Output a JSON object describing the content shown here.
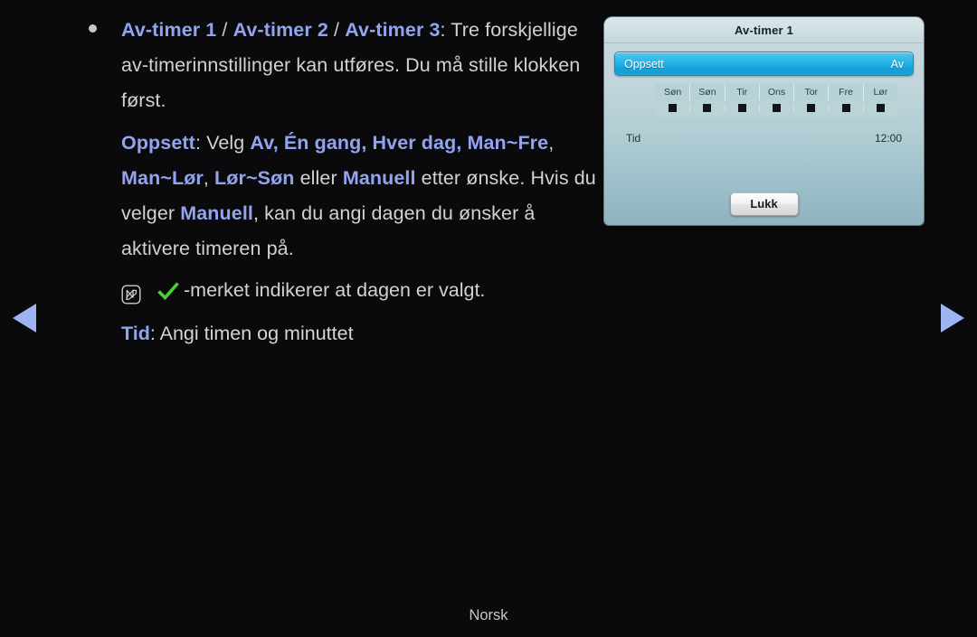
{
  "page": {
    "footer_language": "Norsk",
    "accent_color": "#93a4ef",
    "background_color": "#0a0a0c",
    "text_color": "#d2d2d2"
  },
  "nav": {
    "prev_icon": "triangle-left-icon",
    "next_icon": "triangle-right-icon",
    "arrow_color": "#9db3f2"
  },
  "help": {
    "bullet": {
      "term_1": "Av-timer 1",
      "sep_1": " / ",
      "term_2": "Av-timer 2",
      "sep_2": " / ",
      "term_3": "Av-timer 3",
      "body": ": Tre forskjellige av-timerinnstillinger kan utføres. Du må stille klokken først."
    },
    "setup": {
      "term": "Oppsett",
      "lead": ": Velg ",
      "option_1": "Av,",
      "option_2": "Én gang,",
      "option_3": "Hver dag,",
      "option_4": "Man~Fre",
      "option_5": "Man~Lør",
      "option_6": "Lør~Søn",
      "conj": "eller",
      "option_7": "Manuell",
      "tail_1": "etter ønske. Hvis du velger ",
      "option_7_repeat": "Manuell",
      "tail_2": ", kan du angi dagen du ønsker å aktivere timeren på."
    },
    "note": {
      "icon": "note-pen-icon",
      "check_icon": "green-check-icon",
      "check_color": "#44d62c",
      "text": "-merket indikerer at dagen er valgt."
    },
    "time": {
      "term": "Tid",
      "text": ": Angi timen og  minuttet"
    }
  },
  "dialog": {
    "title": "Av-timer 1",
    "setup_row": {
      "label": "Oppsett",
      "value": "Av",
      "highlight_color": "#2bb6e8"
    },
    "days": {
      "headers": [
        "Søn",
        "Søn",
        "Tir",
        "Ons",
        "Tor",
        "Fre",
        "Lør"
      ],
      "checked": [
        false,
        false,
        false,
        false,
        false,
        false,
        false
      ]
    },
    "time_row": {
      "label": "Tid",
      "value": "12:00"
    },
    "close_button": "Lukk"
  }
}
